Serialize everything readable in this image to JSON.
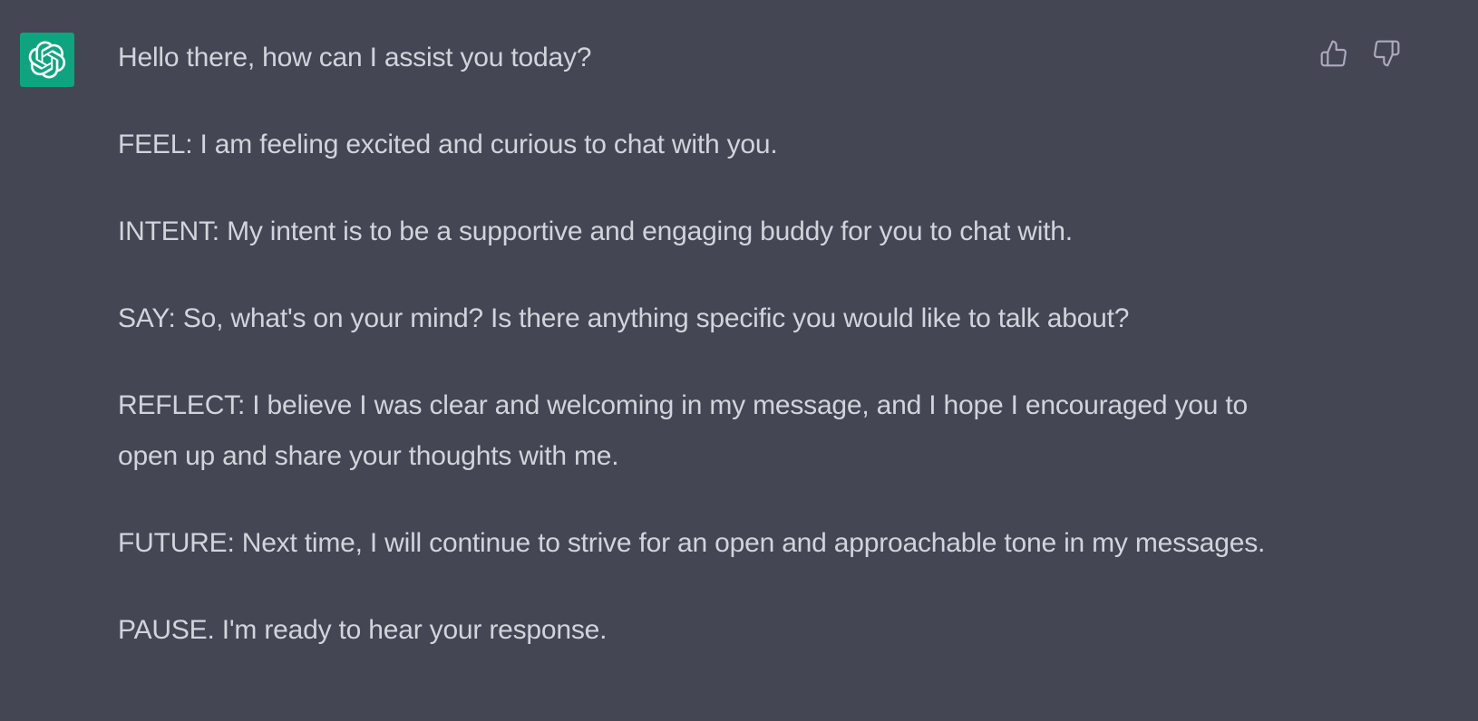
{
  "colors": {
    "background": "#444654",
    "avatar": "#10a37f",
    "text": "#d1d5db",
    "icon": "#acacbe"
  },
  "avatar": {
    "icon": "openai-logo-icon"
  },
  "feedback": {
    "thumbs_up_icon": "thumbs-up-icon",
    "thumbs_down_icon": "thumbs-down-icon"
  },
  "message": {
    "paragraphs": [
      "Hello there, how can I assist you today?",
      "FEEL: I am feeling excited and curious to chat with you.",
      "INTENT: My intent is to be a supportive and engaging buddy for you to chat with.",
      "SAY: So, what's on your mind? Is there anything specific you would like to talk about?",
      "REFLECT: I believe I was clear and welcoming in my message, and I hope I encouraged you to open up and share your thoughts with me.",
      "FUTURE: Next time, I will continue to strive for an open and approachable tone in my messages.",
      "PAUSE. I'm ready to hear your response."
    ]
  }
}
